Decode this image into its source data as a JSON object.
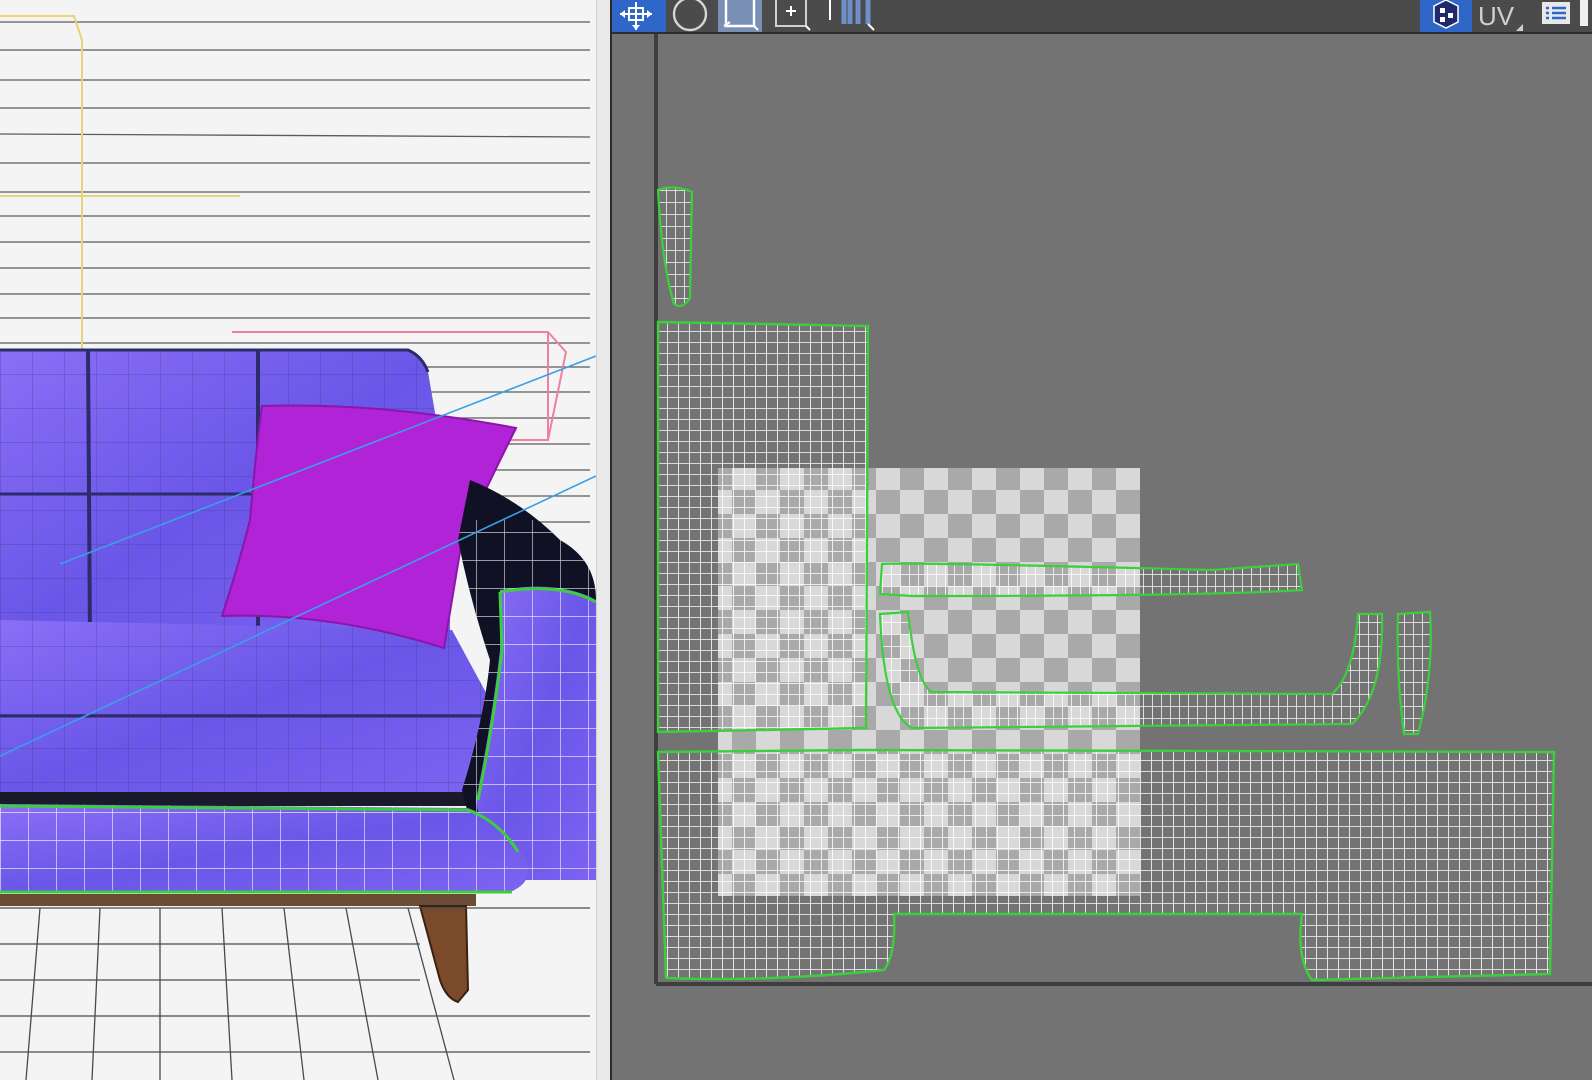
{
  "toolbar": {
    "tools": [
      {
        "name": "move-tool",
        "icon": "move-icon",
        "active": true
      },
      {
        "name": "rotate-tool",
        "icon": "rotate-icon",
        "active": false
      },
      {
        "name": "scale-tool",
        "icon": "scale-icon",
        "active": false
      },
      {
        "name": "freeform-tool",
        "icon": "freeform-icon",
        "active": false
      },
      {
        "name": "mirror-tool",
        "icon": "mirror-icon",
        "active": false
      }
    ],
    "right": {
      "checker_icon": "checker-cube-icon",
      "mode_label": "UV",
      "list_icon": "list-icon"
    }
  },
  "colors": {
    "uv_background": "#737373",
    "uv_wire": "#ffffff",
    "uv_seam": "#3ccf3c",
    "checker_light": "#d8d8d8",
    "checker_dark": "#a9a9a9",
    "sofa_normal": "#7a5cf0",
    "pillow": "#b023d6",
    "leg": "#7a4a2a",
    "selection": "#2f67c9",
    "helper_yellow": "#e8d27a",
    "helper_pink": "#ef7fa6",
    "helper_blue": "#3aa0e6"
  }
}
